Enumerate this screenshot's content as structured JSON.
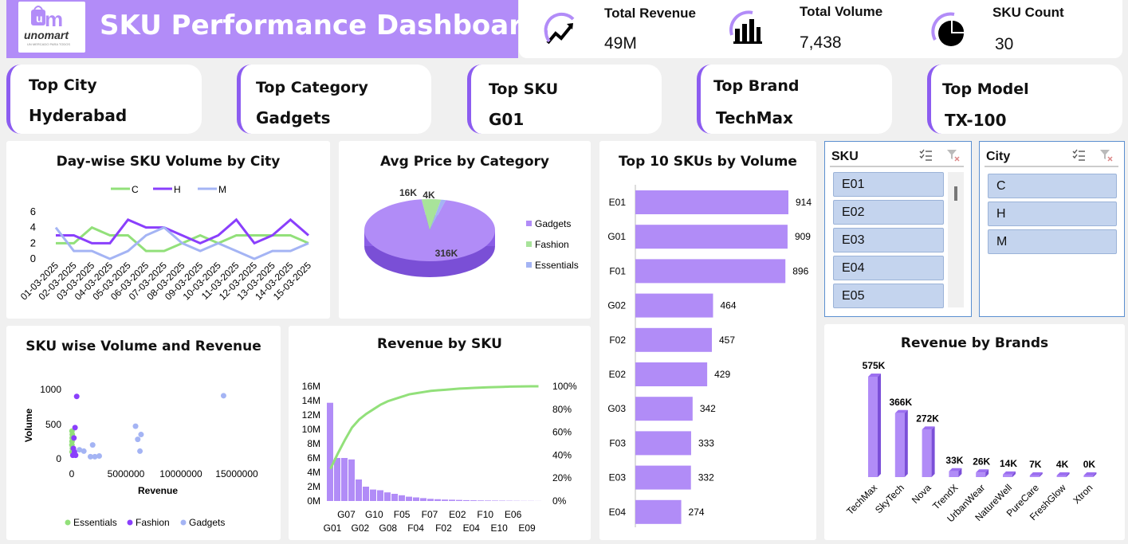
{
  "header": {
    "title": "SKU Performance Dashboard",
    "logo_text": "unomart",
    "logo_subtext": "UN MERCADO PARA TODOS"
  },
  "kpis": [
    {
      "label": "Total Revenue",
      "value": "49M",
      "icon": "growth-chart-icon"
    },
    {
      "label": "Total Volume",
      "value": "7,438",
      "icon": "bar-chart-icon"
    },
    {
      "label": "SKU Count",
      "value": "30",
      "icon": "pie-chart-icon"
    }
  ],
  "tops": [
    {
      "label": "Top City",
      "value": "Hyderabad"
    },
    {
      "label": "Top Category",
      "value": "Gadgets"
    },
    {
      "label": "Top SKU",
      "value": "G01"
    },
    {
      "label": "Top Brand",
      "value": "TechMax"
    },
    {
      "label": "Top Model",
      "value": "TX-100"
    }
  ],
  "slicers": {
    "sku": {
      "label": "SKU",
      "items": [
        "E01",
        "E02",
        "E03",
        "E04",
        "E05"
      ]
    },
    "city": {
      "label": "City",
      "items": [
        "C",
        "H",
        "M"
      ]
    }
  },
  "colors": {
    "purple": "#b18cf7",
    "dark_purple": "#8a3ffc",
    "green": "#92e07a",
    "blue": "#a4b4f4"
  },
  "chart_data": [
    {
      "type": "line",
      "title": "Day-wise SKU Volume by City",
      "x": [
        "01-03-2025",
        "02-03-2025",
        "03-03-2025",
        "04-03-2025",
        "05-03-2025",
        "06-03-2025",
        "07-03-2025",
        "08-03-2025",
        "09-03-2025",
        "10-03-2025",
        "11-03-2025",
        "12-03-2025",
        "13-03-2025",
        "14-03-2025",
        "15-03-2025"
      ],
      "yticks": [
        0,
        2,
        4,
        6
      ],
      "ylim": [
        0,
        6
      ],
      "legend": "top",
      "series": [
        {
          "name": "C",
          "color": "#92e07a",
          "values": [
            2,
            2,
            4,
            3,
            3,
            1,
            1,
            2,
            3,
            2,
            3,
            3,
            3,
            3,
            2
          ]
        },
        {
          "name": "H",
          "color": "#8a3ffc",
          "values": [
            3,
            3,
            2,
            2,
            5,
            4,
            4,
            3,
            2,
            3,
            5,
            2,
            3,
            5,
            3
          ]
        },
        {
          "name": "M",
          "color": "#a4b4f4",
          "values": [
            4,
            1,
            1,
            0,
            1,
            3,
            4,
            2,
            1,
            2,
            1,
            0,
            1,
            1,
            2
          ]
        }
      ]
    },
    {
      "type": "pie",
      "title": "Avg Price by Category",
      "legend": "right",
      "slices": [
        {
          "name": "Gadgets",
          "value": 316,
          "label": "316K",
          "color": "#b18cf7"
        },
        {
          "name": "Fashion",
          "value": 16,
          "label": "16K",
          "color": "#a8e39a"
        },
        {
          "name": "Essentials",
          "value": 4,
          "label": "4K",
          "color": "#a4b4f4"
        }
      ]
    },
    {
      "type": "bar",
      "title": "Top 10 SKUs by Volume",
      "orientation": "horizontal",
      "categories": [
        "E01",
        "G01",
        "F01",
        "G02",
        "F02",
        "E02",
        "G03",
        "F03",
        "E03",
        "E04"
      ],
      "values": [
        914,
        909,
        896,
        464,
        457,
        429,
        342,
        333,
        332,
        274
      ]
    },
    {
      "type": "scatter",
      "title": "SKU wise Volume and Revenue",
      "xlabel": "Revenue",
      "ylabel": "Volume",
      "xticks": [
        "0",
        "5000000",
        "10000000",
        "15000000"
      ],
      "yticks": [
        "0",
        "500",
        "1000"
      ],
      "xlim": [
        0,
        15000000
      ],
      "ylim": [
        0,
        1000
      ],
      "legend": "bottom",
      "series": [
        {
          "name": "Essentials",
          "color": "#92e07a",
          "points": [
            [
              20000,
              400
            ],
            [
              40000,
              300
            ],
            [
              15000,
              200
            ],
            [
              60000,
              150
            ],
            [
              30000,
              100
            ],
            [
              25000,
              250
            ],
            [
              50000,
              350
            ]
          ]
        },
        {
          "name": "Fashion",
          "color": "#8a3ffc",
          "points": [
            [
              450000,
              900
            ],
            [
              300000,
              450
            ],
            [
              200000,
              300
            ],
            [
              150000,
              150
            ],
            [
              250000,
              100
            ],
            [
              100000,
              50
            ],
            [
              350000,
              50
            ]
          ]
        },
        {
          "name": "Gadgets",
          "color": "#a4b4f4",
          "points": [
            [
              13800000,
              910
            ],
            [
              5800000,
              470
            ],
            [
              6300000,
              350
            ],
            [
              6000000,
              280
            ],
            [
              6200000,
              110
            ],
            [
              1900000,
              200
            ],
            [
              1100000,
              110
            ],
            [
              1700000,
              30
            ],
            [
              2100000,
              30
            ],
            [
              2500000,
              40
            ],
            [
              700000,
              130
            ]
          ]
        }
      ]
    },
    {
      "type": "bar",
      "title": "Revenue by SKU",
      "subtype": "pareto",
      "categories": [
        "G01",
        "G07",
        "G02",
        "G10",
        "G08",
        "F05",
        "F04",
        "F07",
        "F02",
        "E02",
        "E04",
        "F10",
        "E10",
        "E06",
        "E09"
      ],
      "bars_in_millions": [
        13.7,
        6,
        6,
        5.8,
        3,
        2,
        1.6,
        1.5,
        1.2,
        1.0,
        0.8,
        0.6,
        0.5,
        0.4,
        0.3,
        0.25,
        0.2,
        0.18,
        0.15,
        0.12,
        0.1,
        0.08,
        0.07,
        0.06,
        0.05,
        0.04,
        0.03,
        0.02,
        0.02,
        0.01
      ],
      "cumulative_pct": [
        28,
        41,
        53,
        64,
        71,
        76,
        80,
        84,
        87,
        89,
        91,
        93,
        94,
        95,
        96,
        96.5,
        97,
        97.5,
        98,
        98.3,
        98.6,
        98.9,
        99.1,
        99.3,
        99.5,
        99.7,
        99.8,
        99.9,
        100,
        100
      ],
      "yticks": [
        "0M",
        "2M",
        "4M",
        "6M",
        "8M",
        "10M",
        "12M",
        "14M",
        "16M"
      ],
      "y2ticks": [
        "0%",
        "20%",
        "40%",
        "60%",
        "80%",
        "100%"
      ],
      "ylim": [
        0,
        16
      ]
    },
    {
      "type": "bar",
      "title": "Revenue by Brands",
      "categories": [
        "TechMax",
        "SkyTech",
        "Nova",
        "TrendX",
        "UrbanWear",
        "NatureWell",
        "PureCare",
        "FreshGlow",
        "Xtron"
      ],
      "values": [
        575,
        366,
        272,
        33,
        26,
        14,
        7,
        4,
        0
      ],
      "labels": [
        "575K",
        "366K",
        "272K",
        "33K",
        "26K",
        "14K",
        "7K",
        "4K",
        "0K"
      ]
    }
  ]
}
